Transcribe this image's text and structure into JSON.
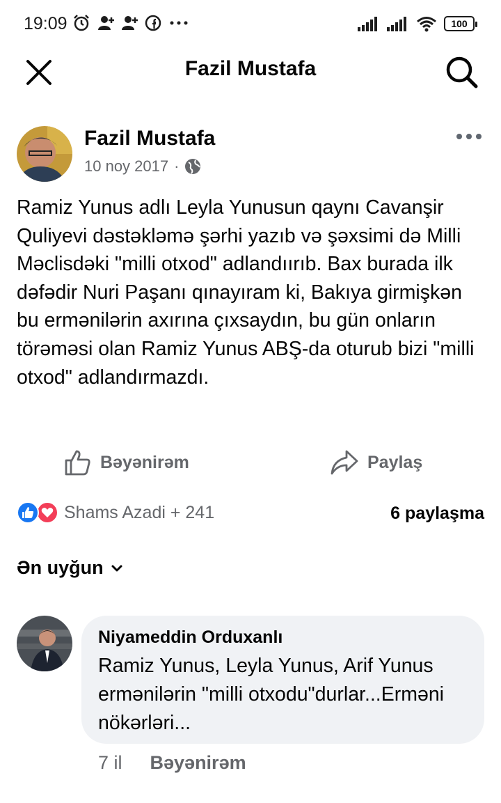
{
  "status_bar": {
    "time": "19:09",
    "battery": "100",
    "icons": [
      "alarm-icon",
      "add-user-icon",
      "add-user-icon",
      "facebook-icon",
      "more-icon",
      "signal-icon",
      "signal-icon",
      "wifi-icon",
      "battery-icon"
    ]
  },
  "header": {
    "title": "Fazil Mustafa"
  },
  "post": {
    "author": "Fazil Mustafa",
    "date": "10 noy 2017",
    "separator": "·",
    "text": "Ramiz Yunus adlı Leyla Yunusun qaynı Cavanşir Quliyevi dəstəkləmə şərhi yazıb və şəxsimi də Milli Məclisdəki \"milli otxod\" adlandıırıb. Bax burada ilk dəfədir Nuri Paşanı qınayıram ki, Bakıya girmişkən bu ermənilərin axırına çıxsaydın, bu gün onların törəməsi olan Ramiz Yunus ABŞ-da oturub bizi \"milli otxod\" adlandırmazdı.",
    "like_label": "Bəyənirəm",
    "share_label": "Paylaş",
    "reactors": "Shams Azadi + 241",
    "shares": "6 paylaşma"
  },
  "comments": {
    "sort_label": "Ən uyğun",
    "items": [
      {
        "author": "Niyameddin Orduxanlı",
        "text": "Ramiz Yunus, Leyla Yunus, Arif Yunus  ermənilərin \"milli otxodu\"durlar...Erməni nökərləri...",
        "age": "7 il",
        "like_label": "Bəyənirəm"
      }
    ]
  },
  "colors": {
    "like_blue": "#1877f2",
    "love_red": "#f33e58",
    "secondary_text": "#65676b",
    "bubble_bg": "#f0f2f5"
  }
}
